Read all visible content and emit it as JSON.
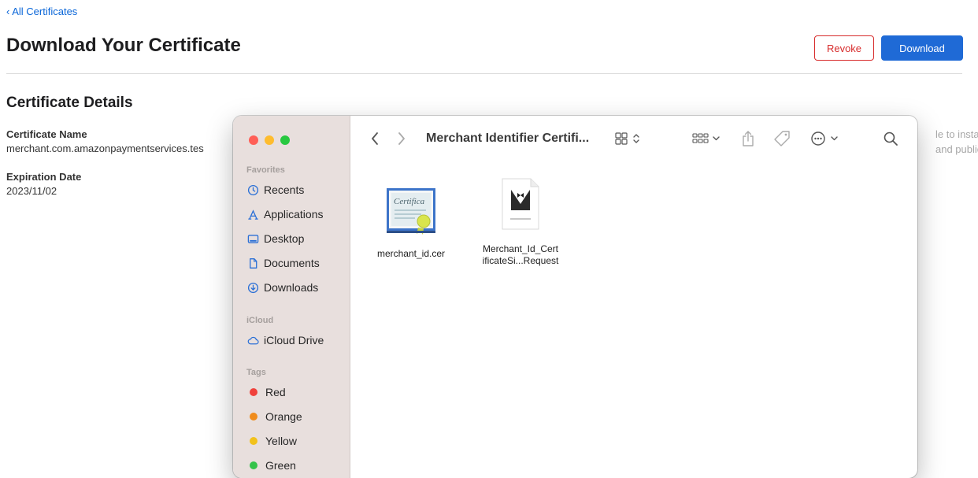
{
  "page": {
    "back_link": "‹ All Certificates",
    "title": "Download Your Certificate",
    "revoke_label": "Revoke",
    "download_label": "Download",
    "section_title": "Certificate Details",
    "cert_name_label": "Certificate Name",
    "cert_name_value": "merchant.com.amazonpaymentservices.tes",
    "expiration_label": "Expiration Date",
    "expiration_value": "2023/11/02",
    "right_text_1": "le to install",
    "right_text_2": "and public"
  },
  "finder": {
    "title": "Merchant Identifier Certifi...",
    "sidebar": {
      "favorites_heading": "Favorites",
      "favorites": [
        {
          "label": "Recents",
          "icon": "clock-icon"
        },
        {
          "label": "Applications",
          "icon": "applications-icon"
        },
        {
          "label": "Desktop",
          "icon": "desktop-icon"
        },
        {
          "label": "Documents",
          "icon": "document-icon"
        },
        {
          "label": "Downloads",
          "icon": "download-circle-icon"
        }
      ],
      "icloud_heading": "iCloud",
      "icloud": [
        {
          "label": "iCloud Drive",
          "icon": "cloud-icon"
        }
      ],
      "tags_heading": "Tags",
      "tags": [
        {
          "label": "Red",
          "color": "#f0413b"
        },
        {
          "label": "Orange",
          "color": "#f08c1c"
        },
        {
          "label": "Yellow",
          "color": "#f2c21b"
        },
        {
          "label": "Green",
          "color": "#34c34a"
        }
      ]
    },
    "files": [
      {
        "name": "merchant_id.cer",
        "icon": "certificate-icon"
      },
      {
        "name": "Merchant_Id_Cert ificateSi...Request",
        "line1": "Merchant_Id_Cert",
        "line2": "ificateSi...Request",
        "icon": "certificate-request-icon"
      }
    ],
    "cert_icon_text": "Certifica"
  },
  "colors": {
    "accent": "#1f6ad6",
    "revoke": "#d72c2c",
    "link": "#0a66d8"
  }
}
